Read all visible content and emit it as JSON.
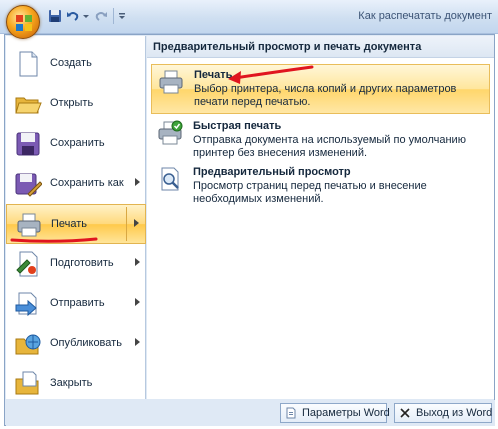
{
  "window": {
    "title": "Как распечатать документ"
  },
  "quick_access": {
    "icons": [
      "save-icon",
      "undo-icon",
      "dropdown-icon",
      "redo-icon",
      "customize-icon"
    ]
  },
  "office_menu": {
    "left_items": [
      {
        "label": "Создать",
        "icon": "new-document-icon",
        "has_submenu": false
      },
      {
        "label": "Открыть",
        "icon": "open-folder-icon",
        "has_submenu": false
      },
      {
        "label": "Сохранить",
        "icon": "save-disk-icon",
        "has_submenu": false
      },
      {
        "label": "Сохранить как",
        "icon": "save-as-icon",
        "has_submenu": true
      },
      {
        "label": "Печать",
        "icon": "printer-icon",
        "has_submenu": true,
        "active": true
      },
      {
        "label": "Подготовить",
        "icon": "prepare-icon",
        "has_submenu": true
      },
      {
        "label": "Отправить",
        "icon": "send-icon",
        "has_submenu": true
      },
      {
        "label": "Опубликовать",
        "icon": "publish-icon",
        "has_submenu": true
      },
      {
        "label": "Закрыть",
        "icon": "close-folder-icon",
        "has_submenu": false
      }
    ],
    "submenu": {
      "header": "Предварительный просмотр и печать документа",
      "items": [
        {
          "title": "Печать",
          "description": "Выбор принтера, числа копий и других параметров печати перед печатью.",
          "icon": "printer-icon",
          "active": true
        },
        {
          "title": "Быстрая печать",
          "description": "Отправка документа на используемый по умолчанию принтер без внесения изменений.",
          "icon": "quick-print-icon"
        },
        {
          "title": "Предварительный просмотр",
          "description": "Просмотр страниц перед печатью и внесение необходимых изменений.",
          "icon": "print-preview-icon"
        }
      ]
    },
    "bottom_buttons": {
      "options": "Параметры Word",
      "exit": "Выход из Word"
    }
  },
  "colors": {
    "highlight": "#ffd97c",
    "annotation_red": "#e0151f"
  }
}
